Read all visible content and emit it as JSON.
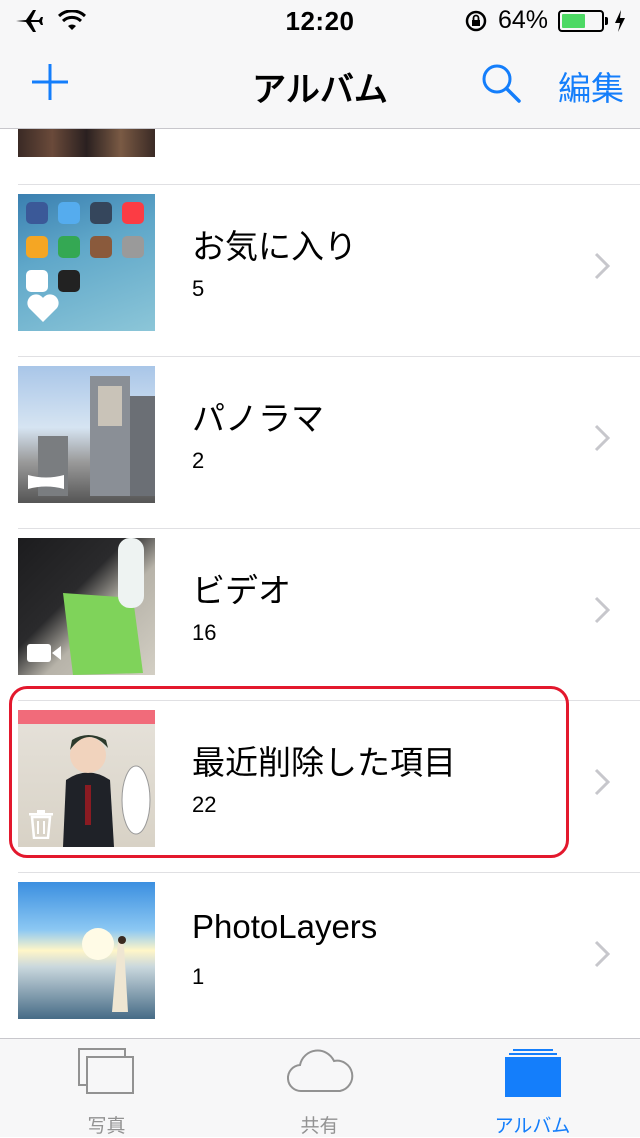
{
  "status_bar": {
    "time": "12:20",
    "battery_percent": "64%",
    "battery_level": 0.64
  },
  "nav": {
    "title": "アルバム",
    "edit_label": "編集"
  },
  "albums": [
    {
      "name": "お気に入り",
      "count": "5"
    },
    {
      "name": "パノラマ",
      "count": "2"
    },
    {
      "name": "ビデオ",
      "count": "16"
    },
    {
      "name": "最近削除した項目",
      "count": "22"
    },
    {
      "name": "PhotoLayers",
      "count": "1"
    }
  ],
  "tabs": [
    {
      "label": "写真"
    },
    {
      "label": "共有"
    },
    {
      "label": "アルバム"
    }
  ],
  "colors": {
    "accent": "#147efb",
    "highlight": "#e3182d",
    "battery": "#4cd964"
  }
}
